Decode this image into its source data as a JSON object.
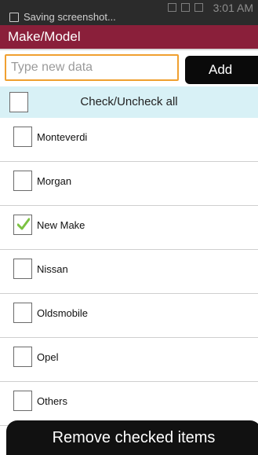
{
  "status_bar": {
    "notification_text": "Saving screenshot...",
    "time": "3:01 AM"
  },
  "header": {
    "title": "Make/Model"
  },
  "input": {
    "placeholder": "Type new data",
    "value": "",
    "add_label": "Add"
  },
  "check_all": {
    "label": "Check/Uncheck all",
    "checked": false
  },
  "items": [
    {
      "label": "Monteverdi",
      "checked": false
    },
    {
      "label": "Morgan",
      "checked": false
    },
    {
      "label": "New Make",
      "checked": true
    },
    {
      "label": "Nissan",
      "checked": false
    },
    {
      "label": "Oldsmobile",
      "checked": false
    },
    {
      "label": "Opel",
      "checked": false
    },
    {
      "label": "Others",
      "checked": false
    }
  ],
  "footer": {
    "remove_label": "Remove checked items"
  },
  "colors": {
    "title_bar": "#8a1f3a",
    "input_focus_border": "#f0a030",
    "check_all_bg": "#d8f1f6",
    "checkmark": "#7cc242"
  }
}
